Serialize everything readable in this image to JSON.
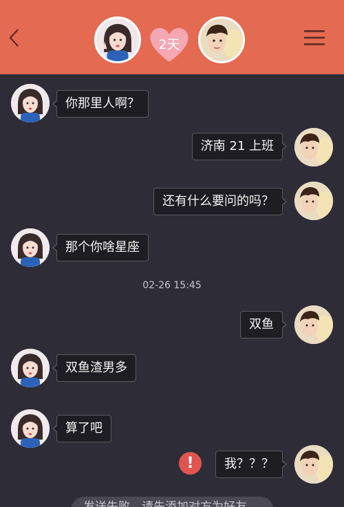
{
  "header": {
    "days_together": "2天",
    "back_icon": "chevron-left-icon",
    "menu_icon": "hamburger-menu-icon",
    "accent_color": "#e46a52"
  },
  "messages": [
    {
      "side": "left",
      "text": "你那里人啊？"
    },
    {
      "side": "right",
      "text": "济南 21 上班"
    },
    {
      "side": "right",
      "text": "还有什么要问的吗？"
    },
    {
      "side": "left",
      "text": "那个你啥星座"
    },
    {
      "side": "right",
      "text": "双鱼"
    },
    {
      "side": "left",
      "text": "双鱼渣男多"
    },
    {
      "side": "left",
      "text": "算了吧"
    },
    {
      "side": "right",
      "text": "我？？？"
    }
  ],
  "timestamp": "02-26 15:45",
  "send_error_icon": "exclamation-icon",
  "notice": "发送失败，请先添加对方为好友"
}
